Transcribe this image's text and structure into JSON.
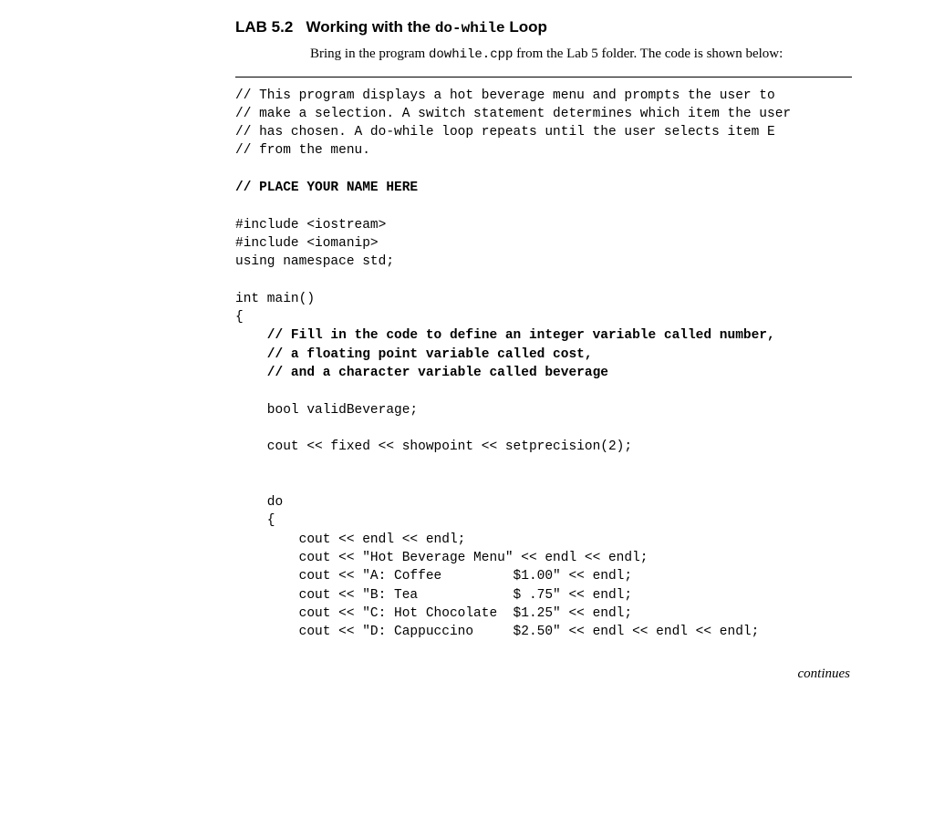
{
  "header": {
    "lab_number": "LAB 5.2",
    "title_before": "Working with the ",
    "title_code": "do-while",
    "title_after": " Loop"
  },
  "intro": {
    "part1": "Bring in the program ",
    "filename": "dowhile.cpp",
    "part2": " from the Lab 5 folder. The code is shown below:"
  },
  "code": {
    "c1": "// This program displays a hot beverage menu and prompts the user to",
    "c2": "// make a selection. A switch statement determines which item the user",
    "c3": "// has chosen. A do-while loop repeats until the user selects item E",
    "c4": "// from the menu.",
    "blank": "",
    "name_here": "// PLACE YOUR NAME HERE",
    "inc1": "#include <iostream>",
    "inc2": "#include <iomanip>",
    "using": "using namespace std;",
    "main1": "int main()",
    "main2": "{",
    "fill1": "    // Fill in the code to define an integer variable called number,",
    "fill2": "    // a floating point variable called cost,",
    "fill3": "    // and a character variable called beverage",
    "bool1": "    bool validBeverage;",
    "cout1": "    cout << fixed << showpoint << setprecision(2);",
    "do1": "    do",
    "do2": "    {",
    "m1": "        cout << endl << endl;",
    "m2": "        cout << \"Hot Beverage Menu\" << endl << endl;",
    "m3": "        cout << \"A: Coffee         $1.00\" << endl;",
    "m4": "        cout << \"B: Tea            $ .75\" << endl;",
    "m5": "        cout << \"C: Hot Chocolate  $1.25\" << endl;",
    "m6": "        cout << \"D: Cappuccino     $2.50\" << endl << endl << endl;"
  },
  "continues": "continues"
}
